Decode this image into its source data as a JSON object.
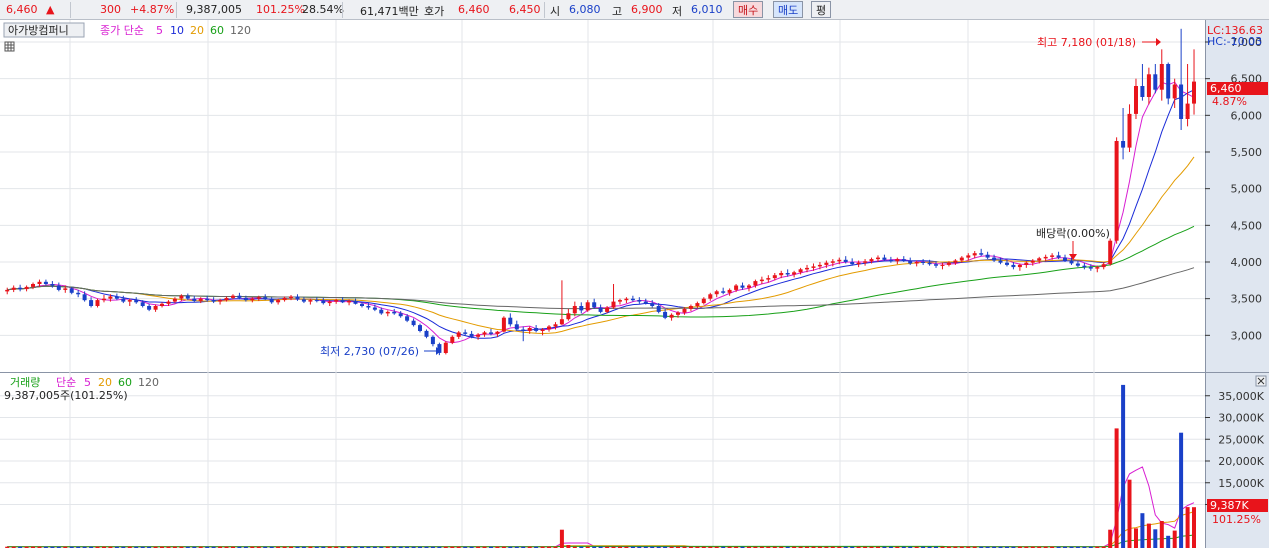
{
  "quote_bar": {
    "price": "6,460",
    "up_arrow": "▲",
    "change": "300",
    "change_pct": "+4.87%",
    "volume": "9,387,005",
    "volume_ratio": "101.25%",
    "turnover_pct": "28.54%",
    "trade_value": "61,471백만",
    "bid_label": "호가",
    "bid1": "6,460",
    "bid2": "6,450",
    "open_label": "시",
    "open": "6,080",
    "high_label": "고",
    "high": "6,900",
    "low_label": "저",
    "low": "6,010",
    "buy_button": "매수",
    "sell_button": "매도",
    "avg_button": "평"
  },
  "price_panel": {
    "stock_name": "아가방컴퍼니",
    "ma_label": "종가 단순",
    "ma_periods": [
      "5",
      "10",
      "20",
      "60",
      "120"
    ],
    "ma_colors": [
      "#d81ed2",
      "#1a2bd8",
      "#e39b00",
      "#18a018",
      "#666666"
    ],
    "lc_label": "LC:136.63",
    "hc_label": "HC:-10.03",
    "current_price_tag": "6,460",
    "current_pct_tag": "4.87%",
    "high_annotation": "최고 7,180 (01/18)",
    "low_annotation": "최저 2,730 (07/26)",
    "event_annotation": "배당락(0.00%)",
    "y_ticks": [
      "7,000",
      "6,500",
      "6,000",
      "5,500",
      "5,000",
      "4,500",
      "4,000",
      "3,500",
      "3,000"
    ]
  },
  "volume_panel": {
    "title": "거래량",
    "ma_label": "단순",
    "ma_periods": [
      "5",
      "20",
      "60",
      "120"
    ],
    "value_label": "9,387,005주(101.25%)",
    "y_ticks": [
      "35,000K",
      "30,000K",
      "25,000K",
      "20,000K",
      "15,000K",
      "10,000K"
    ],
    "current_volume_tag": "9,387K",
    "current_pct_tag": "101.25%"
  },
  "colors": {
    "up": "#e8141b",
    "down": "#1a40c8",
    "axis_bg": "#dfe6f0",
    "grid": "#e3e6ea"
  },
  "chart_data": {
    "type": "candlestick",
    "price_axis_ylim": [
      2500,
      7300
    ],
    "volume_axis_ylim": [
      0,
      40000
    ],
    "volume_unit": "K",
    "highest": {
      "price": 7180,
      "date": "01/18"
    },
    "lowest": {
      "price": 2730,
      "date": "07/26"
    },
    "candles_ohlcv": [
      [
        3600,
        3650,
        3560,
        3620,
        300
      ],
      [
        3620,
        3680,
        3590,
        3650,
        300
      ],
      [
        3650,
        3690,
        3600,
        3630,
        300
      ],
      [
        3630,
        3680,
        3600,
        3660,
        300
      ],
      [
        3660,
        3720,
        3630,
        3700,
        300
      ],
      [
        3700,
        3760,
        3660,
        3730,
        300
      ],
      [
        3730,
        3760,
        3680,
        3700,
        300
      ],
      [
        3700,
        3740,
        3650,
        3680,
        300
      ],
      [
        3680,
        3720,
        3600,
        3620,
        300
      ],
      [
        3620,
        3680,
        3580,
        3640,
        300
      ],
      [
        3640,
        3660,
        3560,
        3580,
        300
      ],
      [
        3580,
        3620,
        3520,
        3560,
        300
      ],
      [
        3560,
        3600,
        3460,
        3480,
        300
      ],
      [
        3480,
        3520,
        3380,
        3400,
        300
      ],
      [
        3400,
        3500,
        3380,
        3480,
        300
      ],
      [
        3480,
        3550,
        3450,
        3500,
        300
      ],
      [
        3500,
        3560,
        3460,
        3530,
        300
      ],
      [
        3530,
        3570,
        3480,
        3500,
        300
      ],
      [
        3500,
        3540,
        3440,
        3460,
        300
      ],
      [
        3460,
        3500,
        3400,
        3480,
        300
      ],
      [
        3480,
        3520,
        3430,
        3450,
        300
      ],
      [
        3450,
        3480,
        3380,
        3400,
        300
      ],
      [
        3400,
        3430,
        3330,
        3350,
        300
      ],
      [
        3350,
        3420,
        3320,
        3400,
        300
      ],
      [
        3400,
        3450,
        3380,
        3430,
        300
      ],
      [
        3430,
        3480,
        3400,
        3460,
        300
      ],
      [
        3460,
        3520,
        3440,
        3500,
        300
      ],
      [
        3500,
        3560,
        3470,
        3540,
        300
      ],
      [
        3540,
        3570,
        3480,
        3500,
        300
      ],
      [
        3500,
        3540,
        3450,
        3470,
        300
      ],
      [
        3470,
        3520,
        3440,
        3500,
        300
      ],
      [
        3500,
        3540,
        3460,
        3480,
        300
      ],
      [
        3480,
        3520,
        3440,
        3460,
        300
      ],
      [
        3460,
        3500,
        3420,
        3480,
        300
      ],
      [
        3480,
        3530,
        3460,
        3510,
        300
      ],
      [
        3510,
        3560,
        3490,
        3540,
        300
      ],
      [
        3540,
        3580,
        3490,
        3510,
        300
      ],
      [
        3510,
        3540,
        3460,
        3480,
        300
      ],
      [
        3480,
        3520,
        3450,
        3500,
        300
      ],
      [
        3500,
        3540,
        3470,
        3520,
        300
      ],
      [
        3520,
        3560,
        3480,
        3490,
        300
      ],
      [
        3490,
        3520,
        3430,
        3450,
        300
      ],
      [
        3450,
        3500,
        3420,
        3480,
        300
      ],
      [
        3480,
        3530,
        3460,
        3510,
        300
      ],
      [
        3510,
        3550,
        3480,
        3530,
        300
      ],
      [
        3530,
        3560,
        3470,
        3490,
        300
      ],
      [
        3490,
        3520,
        3440,
        3460,
        300
      ],
      [
        3460,
        3500,
        3420,
        3480,
        300
      ],
      [
        3480,
        3520,
        3450,
        3470,
        300
      ],
      [
        3470,
        3510,
        3420,
        3440,
        300
      ],
      [
        3440,
        3480,
        3400,
        3460,
        300
      ],
      [
        3460,
        3500,
        3430,
        3480,
        300
      ],
      [
        3480,
        3520,
        3440,
        3450,
        300
      ],
      [
        3450,
        3490,
        3410,
        3470,
        300
      ],
      [
        3470,
        3500,
        3420,
        3430,
        300
      ],
      [
        3430,
        3460,
        3380,
        3400,
        300
      ],
      [
        3400,
        3440,
        3350,
        3380,
        300
      ],
      [
        3380,
        3420,
        3330,
        3350,
        300
      ],
      [
        3350,
        3380,
        3280,
        3300,
        300
      ],
      [
        3300,
        3340,
        3260,
        3320,
        300
      ],
      [
        3320,
        3360,
        3280,
        3300,
        300
      ],
      [
        3300,
        3330,
        3240,
        3260,
        300
      ],
      [
        3260,
        3290,
        3180,
        3200,
        300
      ],
      [
        3200,
        3230,
        3120,
        3140,
        300
      ],
      [
        3140,
        3160,
        3040,
        3060,
        300
      ],
      [
        3060,
        3080,
        2960,
        2980,
        300
      ],
      [
        2980,
        3000,
        2850,
        2880,
        300
      ],
      [
        2880,
        2900,
        2730,
        2760,
        300
      ],
      [
        2760,
        2920,
        2740,
        2900,
        300
      ],
      [
        2900,
        3000,
        2880,
        2980,
        300
      ],
      [
        2980,
        3060,
        2950,
        3040,
        300
      ],
      [
        3040,
        3080,
        3000,
        3020,
        300
      ],
      [
        3020,
        3060,
        2960,
        2980,
        300
      ],
      [
        2980,
        3030,
        2940,
        3010,
        300
      ],
      [
        3010,
        3060,
        2980,
        3040,
        300
      ],
      [
        3040,
        3090,
        3000,
        3020,
        300
      ],
      [
        3020,
        3060,
        2980,
        3050,
        300
      ],
      [
        3050,
        3260,
        3040,
        3240,
        300
      ],
      [
        3240,
        3300,
        3120,
        3150,
        300
      ],
      [
        3150,
        3200,
        3060,
        3080,
        300
      ],
      [
        3080,
        3120,
        2920,
        3060,
        300
      ],
      [
        3060,
        3120,
        3020,
        3100,
        300
      ],
      [
        3100,
        3140,
        3040,
        3060,
        300
      ],
      [
        3060,
        3100,
        3000,
        3080,
        300
      ],
      [
        3080,
        3140,
        3050,
        3120,
        300
      ],
      [
        3120,
        3180,
        3080,
        3150,
        300
      ],
      [
        3150,
        3750,
        3140,
        3220,
        4200
      ],
      [
        3220,
        3360,
        3200,
        3300,
        700
      ],
      [
        3300,
        3460,
        3260,
        3400,
        300
      ],
      [
        3400,
        3450,
        3300,
        3340,
        300
      ],
      [
        3340,
        3480,
        3320,
        3450,
        300
      ],
      [
        3450,
        3500,
        3360,
        3380,
        300
      ],
      [
        3380,
        3420,
        3300,
        3320,
        300
      ],
      [
        3320,
        3400,
        3300,
        3380,
        300
      ],
      [
        3380,
        3700,
        3360,
        3460,
        300
      ],
      [
        3460,
        3500,
        3420,
        3480,
        300
      ],
      [
        3480,
        3520,
        3440,
        3500,
        300
      ],
      [
        3500,
        3540,
        3460,
        3480,
        300
      ],
      [
        3480,
        3520,
        3430,
        3460,
        300
      ],
      [
        3460,
        3500,
        3420,
        3440,
        300
      ],
      [
        3440,
        3480,
        3380,
        3400,
        300
      ],
      [
        3400,
        3440,
        3300,
        3320,
        300
      ],
      [
        3320,
        3360,
        3220,
        3240,
        300
      ],
      [
        3240,
        3300,
        3200,
        3280,
        300
      ],
      [
        3280,
        3330,
        3240,
        3310,
        300
      ],
      [
        3310,
        3380,
        3280,
        3360,
        300
      ],
      [
        3360,
        3420,
        3330,
        3400,
        300
      ],
      [
        3400,
        3460,
        3370,
        3440,
        300
      ],
      [
        3440,
        3520,
        3420,
        3500,
        300
      ],
      [
        3500,
        3580,
        3470,
        3560,
        300
      ],
      [
        3560,
        3620,
        3520,
        3600,
        300
      ],
      [
        3600,
        3650,
        3560,
        3580,
        300
      ],
      [
        3580,
        3640,
        3540,
        3620,
        300
      ],
      [
        3620,
        3700,
        3590,
        3680,
        300
      ],
      [
        3680,
        3720,
        3620,
        3650,
        300
      ],
      [
        3650,
        3700,
        3600,
        3680,
        300
      ],
      [
        3680,
        3760,
        3650,
        3740,
        300
      ],
      [
        3740,
        3800,
        3700,
        3760,
        300
      ],
      [
        3760,
        3820,
        3720,
        3780,
        300
      ],
      [
        3780,
        3850,
        3750,
        3820,
        300
      ],
      [
        3820,
        3880,
        3780,
        3850,
        300
      ],
      [
        3850,
        3900,
        3800,
        3830,
        300
      ],
      [
        3830,
        3880,
        3790,
        3860,
        300
      ],
      [
        3860,
        3920,
        3830,
        3900,
        300
      ],
      [
        3900,
        3960,
        3860,
        3920,
        300
      ],
      [
        3920,
        3980,
        3880,
        3940,
        300
      ],
      [
        3940,
        4000,
        3900,
        3960,
        300
      ],
      [
        3960,
        4020,
        3920,
        3990,
        300
      ],
      [
        3990,
        4040,
        3940,
        4010,
        300
      ],
      [
        4010,
        4060,
        3970,
        4030,
        300
      ],
      [
        4030,
        4080,
        3980,
        4000,
        300
      ],
      [
        4000,
        4050,
        3950,
        3970,
        300
      ],
      [
        3970,
        4020,
        3930,
        3990,
        300
      ],
      [
        3990,
        4040,
        3950,
        4010,
        300
      ],
      [
        4010,
        4060,
        3980,
        4040,
        300
      ],
      [
        4040,
        4090,
        4000,
        4060,
        300
      ],
      [
        4060,
        4100,
        4010,
        4030,
        300
      ],
      [
        4030,
        4070,
        3990,
        4010,
        300
      ],
      [
        4010,
        4060,
        3970,
        4040,
        300
      ],
      [
        4040,
        4080,
        4000,
        4020,
        300
      ],
      [
        4020,
        4060,
        3960,
        3980,
        300
      ],
      [
        3980,
        4020,
        3940,
        4000,
        300
      ],
      [
        4000,
        4040,
        3960,
        3990,
        300
      ],
      [
        3990,
        4030,
        3950,
        3970,
        300
      ],
      [
        3970,
        4010,
        3920,
        3950,
        300
      ],
      [
        3950,
        3990,
        3900,
        3960,
        300
      ],
      [
        3960,
        4010,
        3940,
        3990,
        300
      ],
      [
        3990,
        4040,
        3960,
        4020,
        300
      ],
      [
        4020,
        4080,
        3990,
        4060,
        300
      ],
      [
        4060,
        4120,
        4020,
        4090,
        300
      ],
      [
        4090,
        4150,
        4050,
        4120,
        300
      ],
      [
        4120,
        4180,
        4080,
        4100,
        300
      ],
      [
        4100,
        4140,
        4040,
        4060,
        300
      ],
      [
        4060,
        4100,
        4000,
        4020,
        300
      ],
      [
        4020,
        4060,
        3970,
        3990,
        300
      ],
      [
        3990,
        4030,
        3940,
        3960,
        300
      ],
      [
        3960,
        4000,
        3900,
        3930,
        300
      ],
      [
        3930,
        3980,
        3880,
        3960,
        300
      ],
      [
        3960,
        4010,
        3920,
        3990,
        300
      ],
      [
        3990,
        4040,
        3950,
        4020,
        300
      ],
      [
        4020,
        4070,
        3980,
        4050,
        300
      ],
      [
        4050,
        4100,
        4010,
        4070,
        300
      ],
      [
        4070,
        4120,
        4030,
        4090,
        300
      ],
      [
        4090,
        4140,
        4040,
        4060,
        300
      ],
      [
        4060,
        4100,
        4000,
        4020,
        300
      ],
      [
        4020,
        4060,
        3960,
        3980,
        300
      ],
      [
        3980,
        4020,
        3930,
        3950,
        300
      ],
      [
        3950,
        3990,
        3900,
        3930,
        300
      ],
      [
        3930,
        3970,
        3880,
        3910,
        300
      ],
      [
        3910,
        3950,
        3860,
        3930,
        300
      ],
      [
        3930,
        4000,
        3900,
        3970,
        300
      ],
      [
        3970,
        4320,
        3950,
        4290,
        4200
      ],
      [
        4290,
        5700,
        4250,
        5650,
        27500
      ],
      [
        5650,
        6100,
        5400,
        5560,
        37500
      ],
      [
        5560,
        6150,
        5500,
        6020,
        15700
      ],
      [
        6020,
        6500,
        5950,
        6400,
        4500
      ],
      [
        6400,
        6700,
        6200,
        6250,
        8000
      ],
      [
        6250,
        6650,
        6150,
        6560,
        5600
      ],
      [
        6560,
        6700,
        6300,
        6350,
        4300
      ],
      [
        6350,
        6900,
        6200,
        6700,
        6200
      ],
      [
        6700,
        6720,
        6150,
        6230,
        2800
      ],
      [
        6230,
        6500,
        6100,
        6420,
        4000
      ],
      [
        6420,
        7180,
        5800,
        5950,
        26500
      ],
      [
        5950,
        6700,
        5850,
        6160,
        9400
      ],
      [
        6160,
        6900,
        6010,
        6460,
        9387
      ]
    ]
  }
}
